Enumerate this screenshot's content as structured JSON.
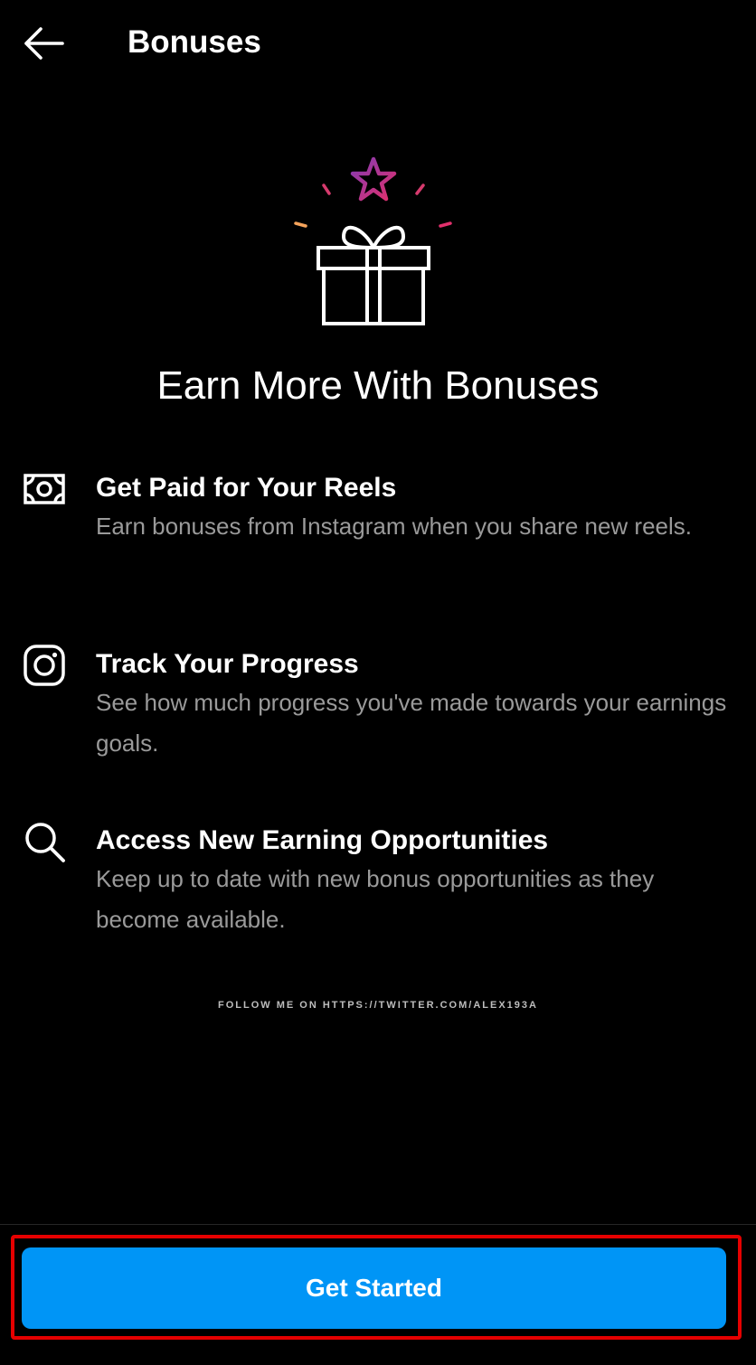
{
  "header": {
    "title": "Bonuses",
    "back_icon": "arrow-left-icon"
  },
  "hero": {
    "icon": "gift-with-star-icon",
    "title": "Earn More With Bonuses",
    "colors": {
      "star_gradient_start": "#c13584",
      "star_gradient_end": "#833ab4",
      "spark_orange": "#f5a35b",
      "spark_pink": "#e1306c"
    }
  },
  "features": [
    {
      "icon": "cash-icon",
      "title": "Get Paid for Your Reels",
      "description": "Earn bonuses from Instagram when you share new reels."
    },
    {
      "icon": "instagram-icon",
      "title": "Track Your Progress",
      "description": "See how much progress you've made towards your earnings goals."
    },
    {
      "icon": "search-icon",
      "title": "Access New Earning Opportunities",
      "description": "Keep up to date with new bonus opportunities as they become available."
    }
  ],
  "watermark": "FOLLOW ME ON HTTPS://TWITTER.COM/ALEX193A",
  "cta": {
    "label": "Get Started",
    "color": "#0095f6",
    "highlight_color": "#e60000"
  }
}
